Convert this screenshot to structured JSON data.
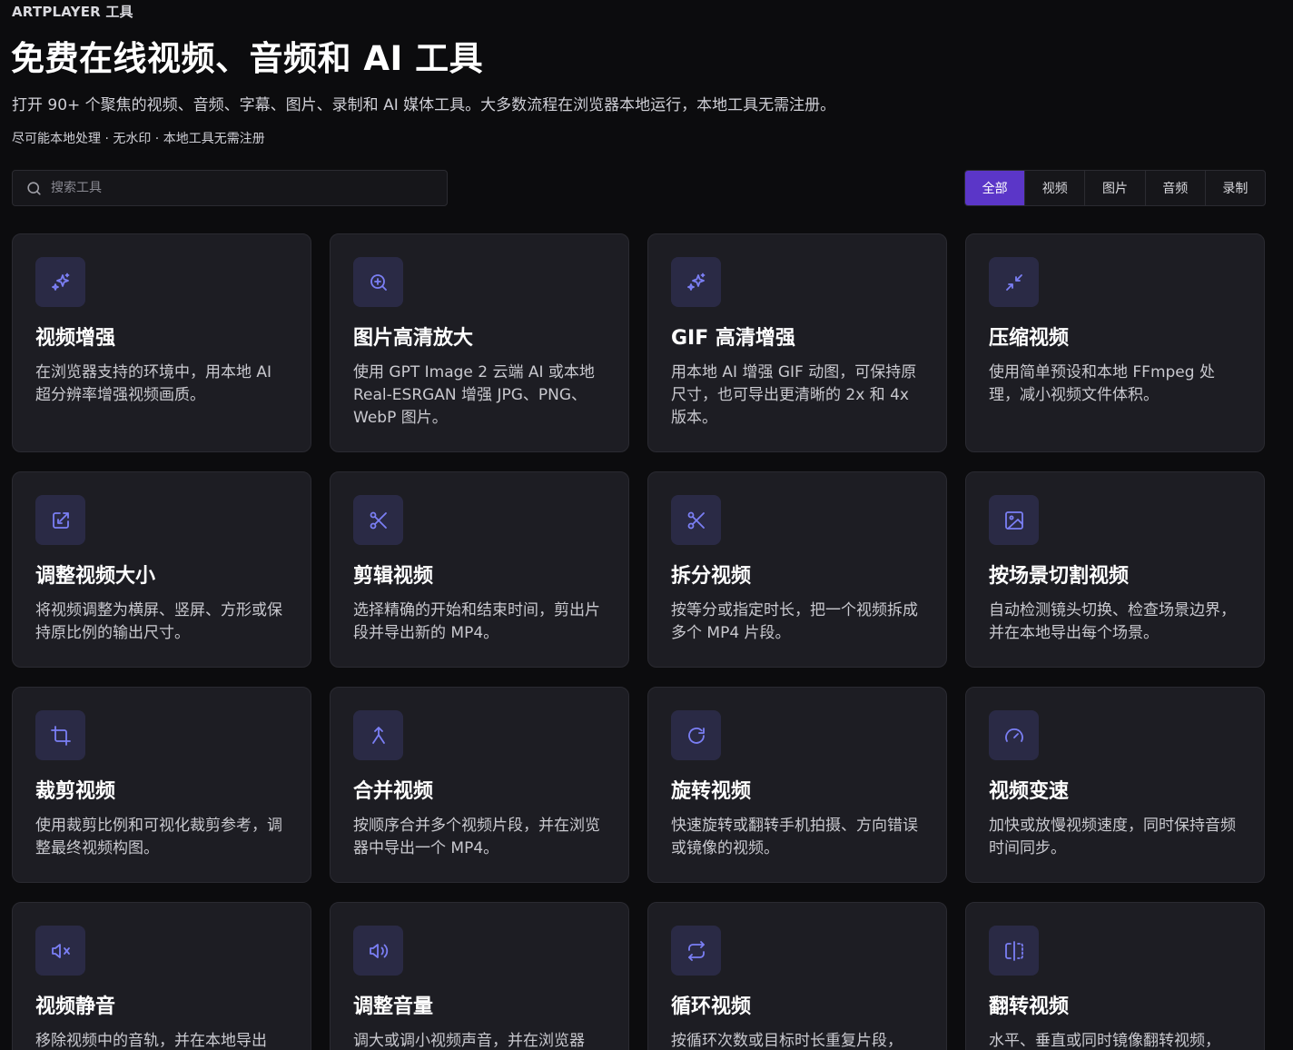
{
  "header": {
    "eyebrow": "ARTPLAYER 工具",
    "title": "免费在线视频、音频和 AI 工具",
    "subtitle": "打开 90+ 个聚焦的视频、音频、字幕、图片、录制和 AI 媒体工具。大多数流程在浏览器本地运行，本地工具无需注册。",
    "note": "尽可能本地处理 · 无水印 · 本地工具无需注册"
  },
  "search": {
    "placeholder": "搜索工具",
    "value": ""
  },
  "filters": [
    {
      "label": "全部",
      "active": true
    },
    {
      "label": "视频",
      "active": false
    },
    {
      "label": "图片",
      "active": false
    },
    {
      "label": "音频",
      "active": false
    },
    {
      "label": "录制",
      "active": false
    }
  ],
  "colors": {
    "accent": "#5b36c8",
    "icon": "#7b7ff5",
    "card_bg": "#1d1d23",
    "icon_bg": "#2a2a45",
    "page_bg": "#0c0c0e"
  },
  "tools": [
    {
      "icon": "sparkles-icon",
      "title": "视频增强",
      "desc": "在浏览器支持的环境中，用本地 AI 超分辨率增强视频画质。"
    },
    {
      "icon": "zoom-in-icon",
      "title": "图片高清放大",
      "desc": "使用 GPT Image 2 云端 AI 或本地 Real-ESRGAN 增强 JPG、PNG、WebP 图片。"
    },
    {
      "icon": "sparkles-icon",
      "title": "GIF 高清增强",
      "desc": "用本地 AI 增强 GIF 动图，可保持原尺寸，也可导出更清晰的 2x 和 4x 版本。"
    },
    {
      "icon": "minimize-icon",
      "title": "压缩视频",
      "desc": "使用简单预设和本地 FFmpeg 处理，减小视频文件体积。"
    },
    {
      "icon": "resize-icon",
      "title": "调整视频大小",
      "desc": "将视频调整为横屏、竖屏、方形或保持原比例的输出尺寸。"
    },
    {
      "icon": "scissors-icon",
      "title": "剪辑视频",
      "desc": "选择精确的开始和结束时间，剪出片段并导出新的 MP4。"
    },
    {
      "icon": "scissors-icon",
      "title": "拆分视频",
      "desc": "按等分或指定时长，把一个视频拆成多个 MP4 片段。"
    },
    {
      "icon": "image-icon",
      "title": "按场景切割视频",
      "desc": "自动检测镜头切换、检查场景边界，并在本地导出每个场景。"
    },
    {
      "icon": "crop-icon",
      "title": "裁剪视频",
      "desc": "使用裁剪比例和可视化裁剪参考，调整最终视频构图。"
    },
    {
      "icon": "merge-icon",
      "title": "合并视频",
      "desc": "按顺序合并多个视频片段，并在浏览器中导出一个 MP4。"
    },
    {
      "icon": "rotate-icon",
      "title": "旋转视频",
      "desc": "快速旋转或翻转手机拍摄、方向错误或镜像的视频。"
    },
    {
      "icon": "gauge-icon",
      "title": "视频变速",
      "desc": "加快或放慢视频速度，同时保持音频时间同步。"
    },
    {
      "icon": "volume-mute-icon",
      "title": "视频静音",
      "desc": "移除视频中的音轨，并在本地导出"
    },
    {
      "icon": "volume-icon",
      "title": "调整音量",
      "desc": "调大或调小视频声音，并在浏览器"
    },
    {
      "icon": "repeat-icon",
      "title": "循环视频",
      "desc": "按循环次数或目标时长重复片段，"
    },
    {
      "icon": "flip-icon",
      "title": "翻转视频",
      "desc": "水平、垂直或同时镜像翻转视频，"
    }
  ]
}
